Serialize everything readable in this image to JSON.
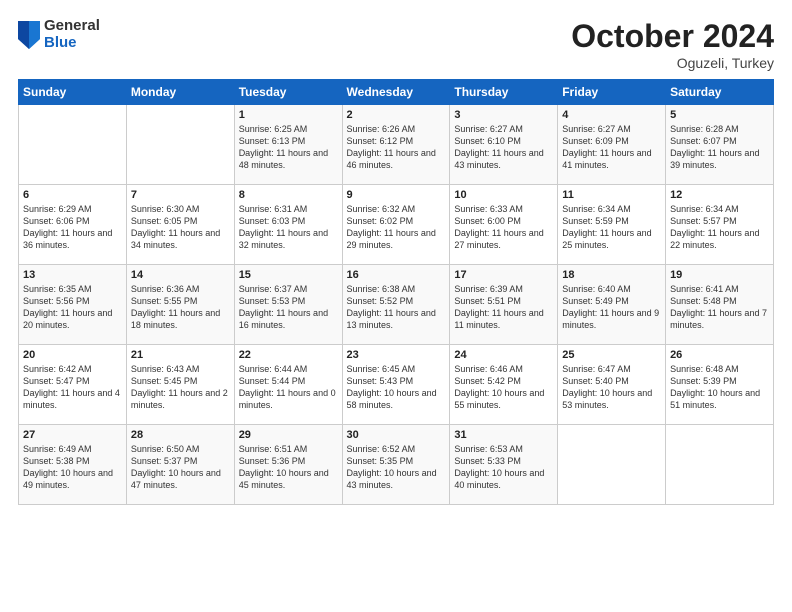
{
  "header": {
    "logo": {
      "general": "General",
      "blue": "Blue"
    },
    "month": "October 2024",
    "location": "Oguzeli, Turkey"
  },
  "days_of_week": [
    "Sunday",
    "Monday",
    "Tuesday",
    "Wednesday",
    "Thursday",
    "Friday",
    "Saturday"
  ],
  "weeks": [
    [
      {
        "day": "",
        "content": ""
      },
      {
        "day": "",
        "content": ""
      },
      {
        "day": "1",
        "content": "Sunrise: 6:25 AM\nSunset: 6:13 PM\nDaylight: 11 hours and 48 minutes."
      },
      {
        "day": "2",
        "content": "Sunrise: 6:26 AM\nSunset: 6:12 PM\nDaylight: 11 hours and 46 minutes."
      },
      {
        "day": "3",
        "content": "Sunrise: 6:27 AM\nSunset: 6:10 PM\nDaylight: 11 hours and 43 minutes."
      },
      {
        "day": "4",
        "content": "Sunrise: 6:27 AM\nSunset: 6:09 PM\nDaylight: 11 hours and 41 minutes."
      },
      {
        "day": "5",
        "content": "Sunrise: 6:28 AM\nSunset: 6:07 PM\nDaylight: 11 hours and 39 minutes."
      }
    ],
    [
      {
        "day": "6",
        "content": "Sunrise: 6:29 AM\nSunset: 6:06 PM\nDaylight: 11 hours and 36 minutes."
      },
      {
        "day": "7",
        "content": "Sunrise: 6:30 AM\nSunset: 6:05 PM\nDaylight: 11 hours and 34 minutes."
      },
      {
        "day": "8",
        "content": "Sunrise: 6:31 AM\nSunset: 6:03 PM\nDaylight: 11 hours and 32 minutes."
      },
      {
        "day": "9",
        "content": "Sunrise: 6:32 AM\nSunset: 6:02 PM\nDaylight: 11 hours and 29 minutes."
      },
      {
        "day": "10",
        "content": "Sunrise: 6:33 AM\nSunset: 6:00 PM\nDaylight: 11 hours and 27 minutes."
      },
      {
        "day": "11",
        "content": "Sunrise: 6:34 AM\nSunset: 5:59 PM\nDaylight: 11 hours and 25 minutes."
      },
      {
        "day": "12",
        "content": "Sunrise: 6:34 AM\nSunset: 5:57 PM\nDaylight: 11 hours and 22 minutes."
      }
    ],
    [
      {
        "day": "13",
        "content": "Sunrise: 6:35 AM\nSunset: 5:56 PM\nDaylight: 11 hours and 20 minutes."
      },
      {
        "day": "14",
        "content": "Sunrise: 6:36 AM\nSunset: 5:55 PM\nDaylight: 11 hours and 18 minutes."
      },
      {
        "day": "15",
        "content": "Sunrise: 6:37 AM\nSunset: 5:53 PM\nDaylight: 11 hours and 16 minutes."
      },
      {
        "day": "16",
        "content": "Sunrise: 6:38 AM\nSunset: 5:52 PM\nDaylight: 11 hours and 13 minutes."
      },
      {
        "day": "17",
        "content": "Sunrise: 6:39 AM\nSunset: 5:51 PM\nDaylight: 11 hours and 11 minutes."
      },
      {
        "day": "18",
        "content": "Sunrise: 6:40 AM\nSunset: 5:49 PM\nDaylight: 11 hours and 9 minutes."
      },
      {
        "day": "19",
        "content": "Sunrise: 6:41 AM\nSunset: 5:48 PM\nDaylight: 11 hours and 7 minutes."
      }
    ],
    [
      {
        "day": "20",
        "content": "Sunrise: 6:42 AM\nSunset: 5:47 PM\nDaylight: 11 hours and 4 minutes."
      },
      {
        "day": "21",
        "content": "Sunrise: 6:43 AM\nSunset: 5:45 PM\nDaylight: 11 hours and 2 minutes."
      },
      {
        "day": "22",
        "content": "Sunrise: 6:44 AM\nSunset: 5:44 PM\nDaylight: 11 hours and 0 minutes."
      },
      {
        "day": "23",
        "content": "Sunrise: 6:45 AM\nSunset: 5:43 PM\nDaylight: 10 hours and 58 minutes."
      },
      {
        "day": "24",
        "content": "Sunrise: 6:46 AM\nSunset: 5:42 PM\nDaylight: 10 hours and 55 minutes."
      },
      {
        "day": "25",
        "content": "Sunrise: 6:47 AM\nSunset: 5:40 PM\nDaylight: 10 hours and 53 minutes."
      },
      {
        "day": "26",
        "content": "Sunrise: 6:48 AM\nSunset: 5:39 PM\nDaylight: 10 hours and 51 minutes."
      }
    ],
    [
      {
        "day": "27",
        "content": "Sunrise: 6:49 AM\nSunset: 5:38 PM\nDaylight: 10 hours and 49 minutes."
      },
      {
        "day": "28",
        "content": "Sunrise: 6:50 AM\nSunset: 5:37 PM\nDaylight: 10 hours and 47 minutes."
      },
      {
        "day": "29",
        "content": "Sunrise: 6:51 AM\nSunset: 5:36 PM\nDaylight: 10 hours and 45 minutes."
      },
      {
        "day": "30",
        "content": "Sunrise: 6:52 AM\nSunset: 5:35 PM\nDaylight: 10 hours and 43 minutes."
      },
      {
        "day": "31",
        "content": "Sunrise: 6:53 AM\nSunset: 5:33 PM\nDaylight: 10 hours and 40 minutes."
      },
      {
        "day": "",
        "content": ""
      },
      {
        "day": "",
        "content": ""
      }
    ]
  ]
}
